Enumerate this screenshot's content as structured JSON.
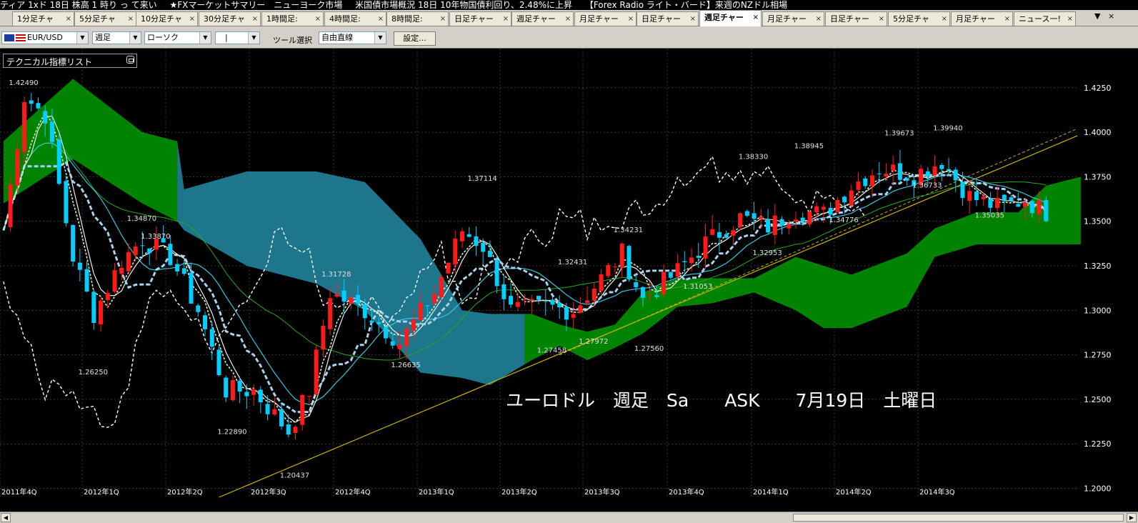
{
  "ticker": [
    "ティア 1xド 18日 株高 1 時り っ て来い",
    "★FXマーケットサマリー　ニューヨーク市場",
    "米国債市場概況 18日 10年物国債利回り、2.48%に上昇",
    "【Forex Radio ライト・バード】来週のNZドル相場"
  ],
  "tabs": [
    {
      "label": "1分足チャ",
      "active": false
    },
    {
      "label": "5分足チャ",
      "active": false
    },
    {
      "label": "10分足チャ",
      "active": false
    },
    {
      "label": "30分足チャ",
      "active": false
    },
    {
      "label": "1時間足:",
      "active": false
    },
    {
      "label": "4時間足:",
      "active": false
    },
    {
      "label": "8時間足:",
      "active": false
    },
    {
      "label": "日足チャー",
      "active": false
    },
    {
      "label": "週足チャー",
      "active": false
    },
    {
      "label": "月足チャー",
      "active": false
    },
    {
      "label": "日足チャー",
      "active": false
    },
    {
      "label": "週足チャー",
      "active": true
    },
    {
      "label": "月足チャー",
      "active": false
    },
    {
      "label": "日足チャー",
      "active": false
    },
    {
      "label": "5分足チャ",
      "active": false
    },
    {
      "label": "月足チャー",
      "active": false
    },
    {
      "label": "ニュース一!",
      "active": false
    }
  ],
  "tab_close": "×",
  "tab_controls": {
    "menu": "▼",
    "close": "×"
  },
  "toolbar": {
    "symbol": "EUR/USD",
    "timeframe": "週足",
    "chart_type": "ローソク",
    "line_style": "|",
    "tool_label": "ツール選択",
    "tool_value": "自由直線",
    "settings_button": "設定..."
  },
  "indicator_panel": {
    "title": "テクニカル指標リスト",
    "icon": "restore-icon"
  },
  "chart_data": {
    "type": "candlestick",
    "instrument": "EUR/USD",
    "timeframe": "週足",
    "y_ticks": [
      "1.4250",
      "1.4000",
      "1.3750",
      "1.3500",
      "1.3250",
      "1.3000",
      "1.2750",
      "1.2500",
      "1.2250",
      "1.2000"
    ],
    "x_ticks": [
      "2011年4Q",
      "2012年1Q",
      "2012年2Q",
      "2012年3Q",
      "2012年4Q",
      "2013年1Q",
      "2013年2Q",
      "2013年3Q",
      "2013年4Q",
      "2014年1Q",
      "2014年2Q",
      "2014年3Q"
    ],
    "ylim": [
      1.195,
      1.447
    ],
    "price_annotations": [
      {
        "label": "1.42490",
        "x": 2,
        "y": 1.4249
      },
      {
        "label": "1.34870",
        "x": 19,
        "y": 1.3487
      },
      {
        "label": "1.33870",
        "x": 21,
        "y": 1.3387
      },
      {
        "label": "1.26250",
        "x": 12,
        "y": 1.2625
      },
      {
        "label": "1.22890",
        "x": 32,
        "y": 1.2289
      },
      {
        "label": "1.20437",
        "x": 41,
        "y": 1.2044
      },
      {
        "label": "1.31728",
        "x": 47,
        "y": 1.3173
      },
      {
        "label": "1.26635",
        "x": 57,
        "y": 1.2664
      },
      {
        "label": "1.37114",
        "x": 68,
        "y": 1.3711
      },
      {
        "label": "1.27458",
        "x": 78,
        "y": 1.2746
      },
      {
        "label": "1.32431",
        "x": 81,
        "y": 1.3243
      },
      {
        "label": "1.27972",
        "x": 84,
        "y": 1.2797
      },
      {
        "label": "1.34231",
        "x": 89,
        "y": 1.3423
      },
      {
        "label": "1.27560",
        "x": 92,
        "y": 1.2756
      },
      {
        "label": "1.31053",
        "x": 99,
        "y": 1.3105
      },
      {
        "label": "1.38330",
        "x": 107,
        "y": 1.3833
      },
      {
        "label": "1.32953",
        "x": 109,
        "y": 1.3295
      },
      {
        "label": "1.38945",
        "x": 115,
        "y": 1.3895
      },
      {
        "label": "1.34776",
        "x": 120,
        "y": 1.3478
      },
      {
        "label": "1.39673",
        "x": 128,
        "y": 1.3967
      },
      {
        "label": "1.36733",
        "x": 132,
        "y": 1.3673
      },
      {
        "label": "1.39940",
        "x": 135,
        "y": 1.3994
      },
      {
        "label": "1.35035",
        "x": 141,
        "y": 1.3504
      }
    ],
    "annotation_text": "ユーロドル　週足　Sa　　ASK　　7月19日　土曜日"
  },
  "colors": {
    "background": "#000000",
    "bull": "#ff1a1a",
    "bear": "#00cfff",
    "cloud_green": "#008a00",
    "cloud_blue": "#1f7c94",
    "tenkan": "#ffffff",
    "kijun": "#a9d2f0",
    "chikou": "#ffffff",
    "ma_short": "#ffffff",
    "ma_mid": "#35c8e0",
    "ma_long": "#22aa22",
    "trendline": "#c8b400"
  }
}
